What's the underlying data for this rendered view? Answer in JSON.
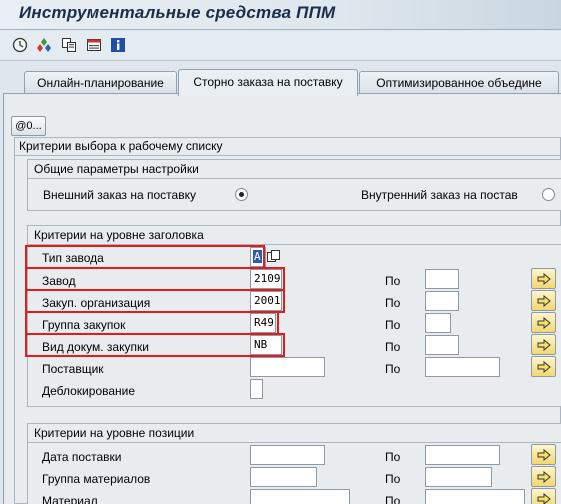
{
  "title": "Инструментальные средства ППМ",
  "toolbar": {
    "icons": [
      "execute-icon",
      "variants-icon",
      "copy-icon",
      "save-variant-icon",
      "info-icon"
    ]
  },
  "tabs": [
    {
      "label": "Онлайн-планирование"
    },
    {
      "label": "Сторно заказа на поставку"
    },
    {
      "label": "Оптимизированное объедине"
    }
  ],
  "at_button": "@0...",
  "main": {
    "title": "Критерии выбора к рабочему списку",
    "general": {
      "title": "Общие параметры настройки",
      "radio_external": "Внешний заказ на поставку",
      "radio_internal": "Внутренний заказ на постав",
      "selected": "external"
    },
    "header": {
      "title": "Критерии на уровне заголовка",
      "to_label": "По",
      "rows": [
        {
          "label": "Тип завода",
          "value": "A"
        },
        {
          "label": "Завод",
          "value": "2109"
        },
        {
          "label": "Закуп. организация",
          "value": "2001"
        },
        {
          "label": "Группа закупок",
          "value": "R49"
        },
        {
          "label": "Вид докум. закупки",
          "value": "NB"
        },
        {
          "label": "Поставщик",
          "value": ""
        },
        {
          "label": "Деблокирование",
          "value": ""
        }
      ]
    },
    "position": {
      "title": "Критерии на уровне позиции",
      "to_label": "По",
      "rows": [
        {
          "label": "Дата поставки"
        },
        {
          "label": "Группа материалов"
        },
        {
          "label": "Материал"
        }
      ]
    }
  },
  "colors": {
    "highlight": "#e21b1b",
    "accent": "#2a5db0"
  }
}
